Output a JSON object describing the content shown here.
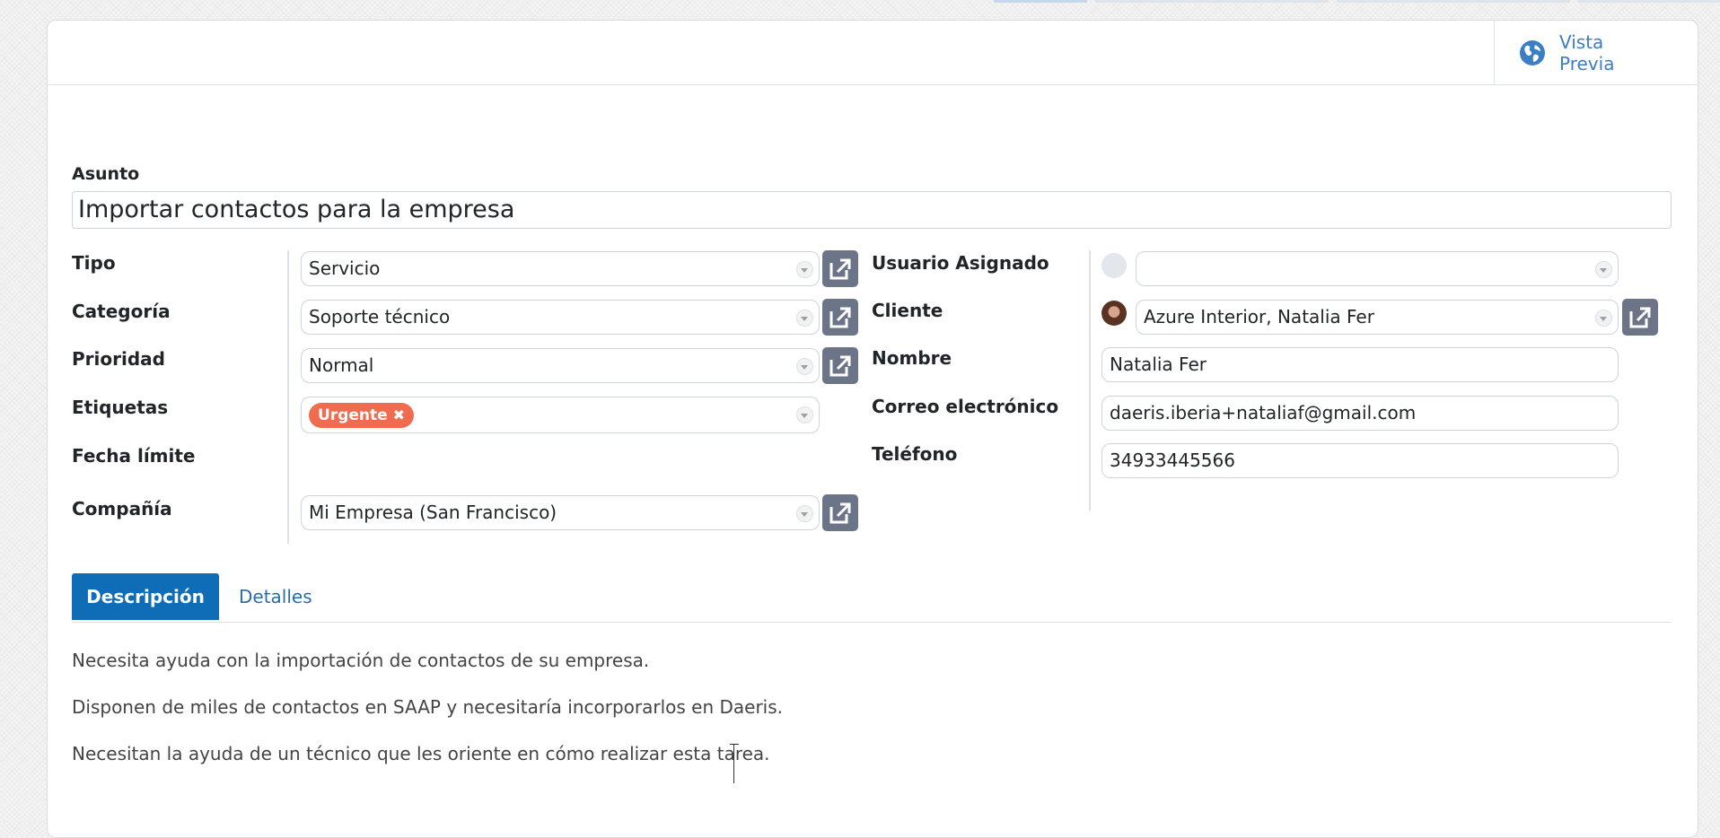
{
  "window": {
    "top_strip_colors": [
      "#c7d7ea",
      "#dfe3ea",
      "#dfe3ea",
      "#dfe3ea"
    ]
  },
  "statusbar": {
    "preview_button": {
      "label": "Vista Previa",
      "icon": "globe-icon"
    }
  },
  "form": {
    "subject": {
      "label": "Asunto",
      "value": "Importar contactos para la empresa"
    },
    "left": {
      "tipo": {
        "label": "Tipo",
        "value": "Servicio"
      },
      "categoria": {
        "label": "Categoría",
        "value": "Soporte técnico"
      },
      "prioridad": {
        "label": "Prioridad",
        "value": "Normal"
      },
      "etiquetas": {
        "label": "Etiquetas",
        "tags": [
          {
            "label": "Urgente",
            "color": "#f06b4f"
          }
        ]
      },
      "fecha_limite": {
        "label": "Fecha límite",
        "value": ""
      },
      "compania": {
        "label": "Compañía",
        "value": "Mi Empresa (San Francisco)"
      }
    },
    "right": {
      "usuario_asignado": {
        "label": "Usuario Asignado",
        "value": ""
      },
      "cliente": {
        "label": "Cliente",
        "value": "Azure Interior, Natalia Fer"
      },
      "nombre": {
        "label": "Nombre",
        "value": "Natalia Fer"
      },
      "correo": {
        "label": "Correo electrónico",
        "value": "daeris.iberia+nataliaf@gmail.com"
      },
      "telefono": {
        "label": "Teléfono",
        "value": "34933445566"
      }
    }
  },
  "tabs": [
    {
      "label": "Descripción",
      "active": true
    },
    {
      "label": "Detalles",
      "active": false
    }
  ],
  "description": {
    "paragraphs": [
      "Necesita ayuda con la importación de contactos de su empresa.",
      "Disponen de miles de contactos en SAAP y necesitaría incorporarlos en Daeris.",
      "Necesitan la ayuda de un técnico que les oriente en cómo realizar esta tarea."
    ]
  },
  "colors": {
    "primary": "#0e6db6",
    "link": "#2a6dab",
    "tag_urgent": "#f06b4f",
    "external_button": "#6c7588"
  }
}
